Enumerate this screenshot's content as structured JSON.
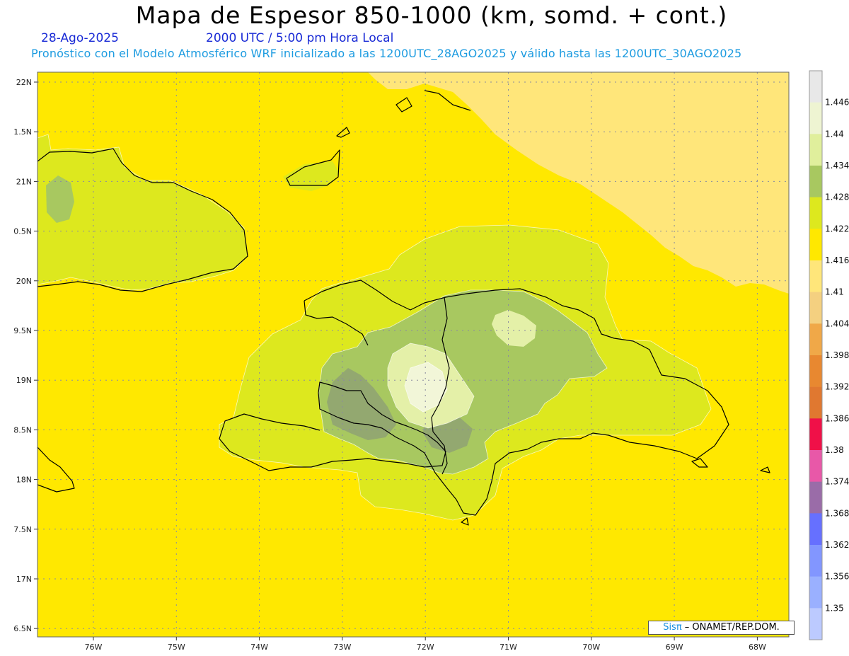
{
  "header": {
    "title": "Mapa de Espesor 850-1000 (km, somd. + cont.)",
    "date": "28-Ago-2025",
    "time": "2000 UTC / 5:00 pm Hora Local",
    "forecast": "Pronóstico con el Modelo Atmosférico WRF inicializado a las 1200UTC_28AGO2025 y válido hasta las  1200UTC_30AGO2025"
  },
  "map": {
    "lat_ticks": [
      "22N",
      "1.5N",
      "21N",
      "0.5N",
      "20N",
      "9.5N",
      "19N",
      "8.5N",
      "18N",
      "7.5N",
      "17N",
      "6.5N"
    ],
    "lon_ticks": [
      "76W",
      "75W",
      "74W",
      "73W",
      "72W",
      "71W",
      "70W",
      "69W",
      "68W"
    ],
    "colors": {
      "ocean": "#ffe800",
      "light_yellow": "#ffe67a",
      "lime": "#dde81e",
      "green": "#a8c860",
      "grey_green": "#93a870",
      "pale": "#e4f0a8",
      "cream": "#f2f6d8",
      "coast": "#000000",
      "gridline": "#8a8aa0"
    }
  },
  "colorbar": {
    "labels": [
      "1.446",
      "1.44",
      "1.434",
      "1.428",
      "1.422",
      "1.416",
      "1.41",
      "1.404",
      "1.398",
      "1.392",
      "1.386",
      "1.38",
      "1.374",
      "1.368",
      "1.362",
      "1.356",
      "1.35"
    ],
    "colors": [
      "#e8e8e8",
      "#eef4d2",
      "#e0ef9c",
      "#a8c860",
      "#dde81e",
      "#ffe800",
      "#ffe67a",
      "#f4d080",
      "#f0a848",
      "#e88830",
      "#e07830",
      "#f01048",
      "#e858a8",
      "#9a6ca8",
      "#6670ff",
      "#8296ff",
      "#9ab0ff",
      "#bccaff"
    ]
  },
  "credit": {
    "brand": "Sisπ",
    "org": " – ONAMET/REP.DOM."
  }
}
